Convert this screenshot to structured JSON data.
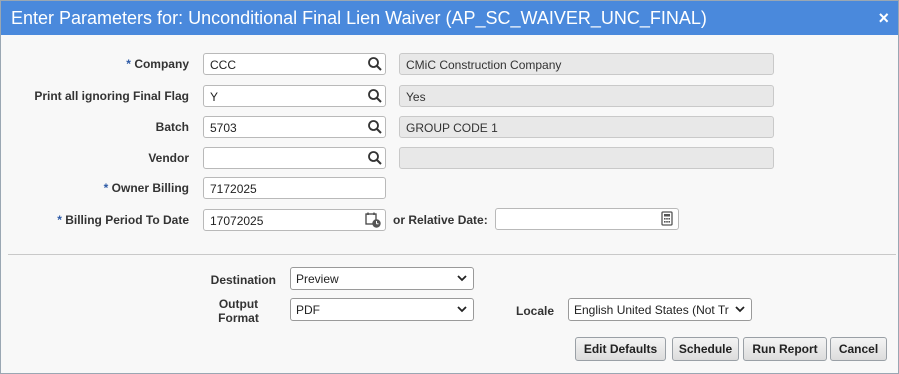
{
  "dialog": {
    "title": "Enter Parameters for: Unconditional Final Lien Waiver (AP_SC_WAIVER_UNC_FINAL)",
    "close_label": "×"
  },
  "fields": {
    "company": {
      "required": "*",
      "label": "Company",
      "value": "CCC",
      "description": "CMiC Construction Company"
    },
    "final_flag": {
      "label": "Print all ignoring Final Flag",
      "value": "Y",
      "description": "Yes"
    },
    "batch": {
      "label": "Batch",
      "value": "5703",
      "description": "GROUP CODE 1"
    },
    "vendor": {
      "label": "Vendor",
      "value": "",
      "description": ""
    },
    "owner_billing": {
      "required": "*",
      "label": "Owner Billing",
      "value": "7172025"
    },
    "billing_period": {
      "required": "*",
      "label": "Billing Period To Date",
      "value": "17072025"
    },
    "relative_date": {
      "label": "or Relative Date:",
      "value": ""
    }
  },
  "output": {
    "destination": {
      "label": "Destination",
      "value": "Preview"
    },
    "format": {
      "label_line1": "Output",
      "label_line2": "Format",
      "value": "PDF"
    },
    "locale": {
      "label": "Locale",
      "value": "English United States (Not Tr"
    }
  },
  "buttons": {
    "edit_defaults": "Edit Defaults",
    "schedule": "Schedule",
    "run_report": "Run Report",
    "cancel": "Cancel"
  },
  "colors": {
    "title_bar": "#4a89dc",
    "required_marker": "#2d5aa6"
  },
  "icons": {
    "lookup": "search-icon",
    "date_picker": "calendar-clock-icon",
    "calculator": "calculator-icon",
    "dropdown": "chevron-down-icon"
  }
}
